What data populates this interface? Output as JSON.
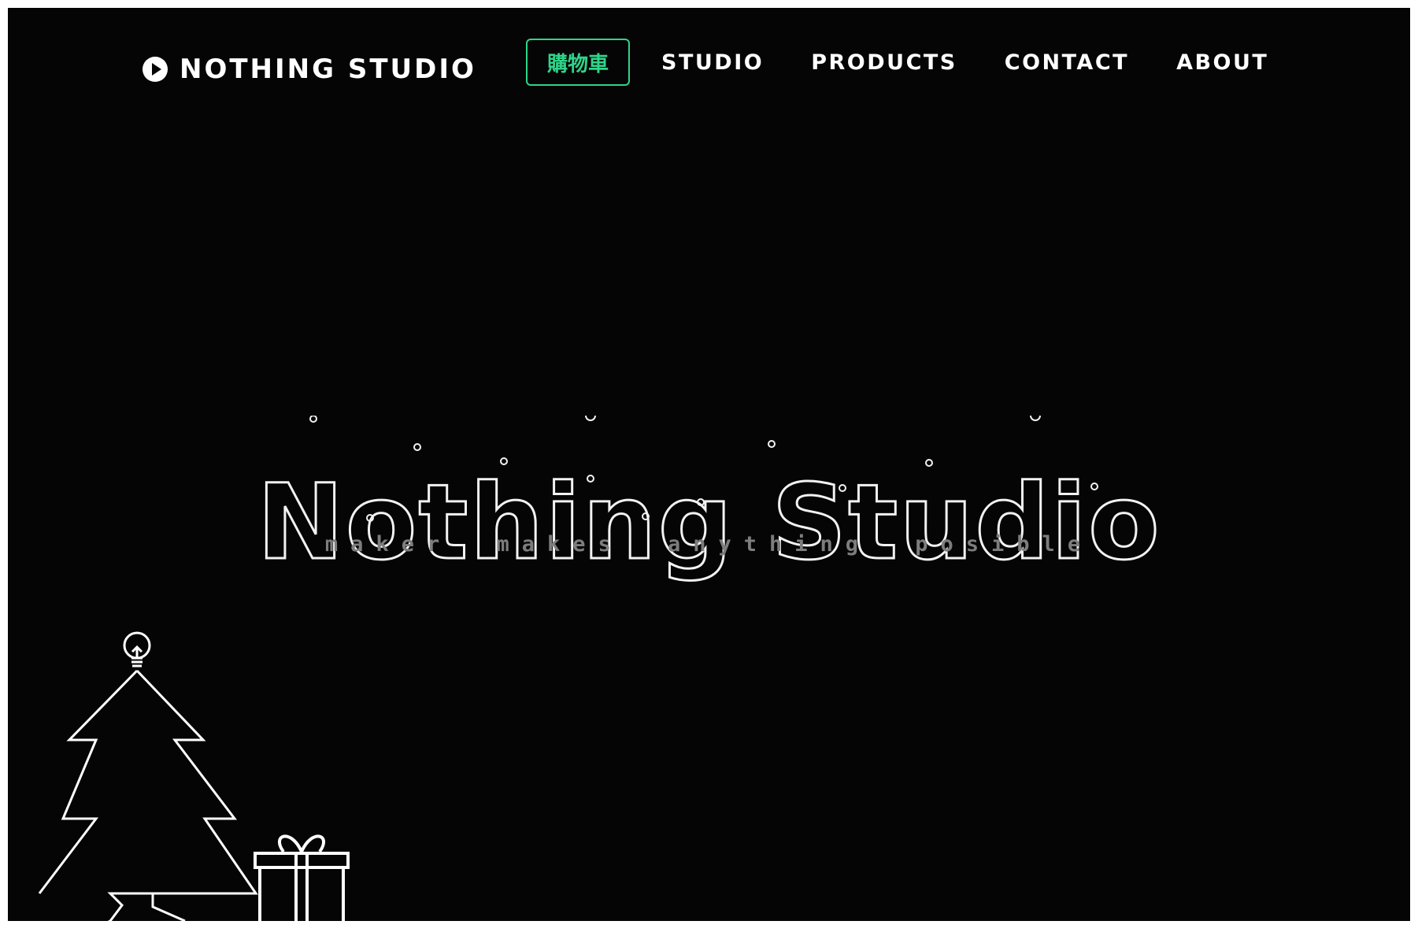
{
  "brand": {
    "name": "NOTHING STUDIO",
    "icon": "play-circle-icon"
  },
  "nav": {
    "cart_label": "購物車",
    "links": [
      "STUDIO",
      "PRODUCTS",
      "CONTACT",
      "ABOUT"
    ]
  },
  "hero": {
    "title": "Nothing Studio",
    "tagline": "maker makes anything posible"
  },
  "decor": {
    "tree_icon": "christmas-tree-icon",
    "bulb_icon": "light-bulb-icon",
    "gift_icon": "gift-box-icon"
  },
  "colors": {
    "background": "#050505",
    "accent": "#2fd48a",
    "text": "#ffffff",
    "tagline": "#7d7d7d"
  }
}
